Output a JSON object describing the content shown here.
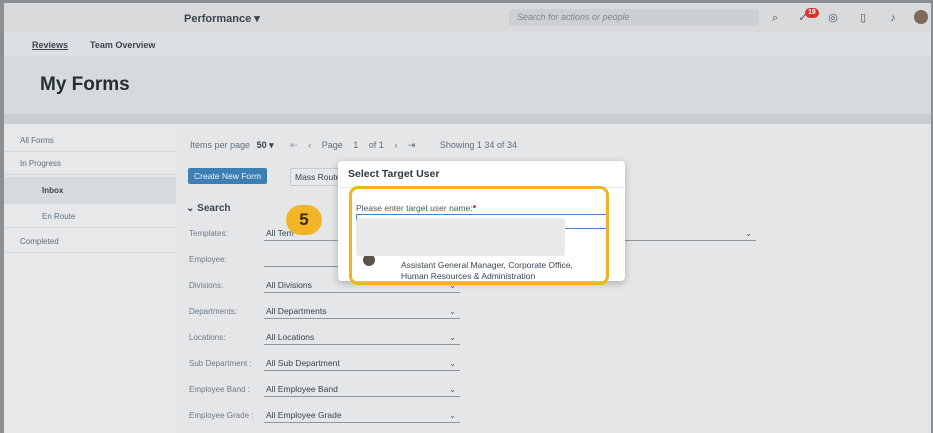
{
  "shell": {
    "app_title": "Performance ▾",
    "search_placeholder": "Search for actions or people",
    "notification_count": "19"
  },
  "subnav": {
    "reviews": "Reviews",
    "team_overview": "Team Overview"
  },
  "page": {
    "title": "My Forms"
  },
  "sidebar": {
    "items": [
      {
        "label": "All Forms"
      },
      {
        "label": "In Progress"
      },
      {
        "label": "Inbox"
      },
      {
        "label": "En Route"
      },
      {
        "label": "Completed"
      }
    ]
  },
  "pager": {
    "items_per_page_label": "Items per page",
    "items_per_page_value": "50",
    "first": "⇤",
    "prev": "‹",
    "page_label": "Page",
    "page_value": "1",
    "of_label": "of 1",
    "next": "›",
    "last": "⇥",
    "showing": "Showing 1 34 of 34"
  },
  "actions": {
    "create_new_form": "Create New Form",
    "mass_route": "Mass Route"
  },
  "search": {
    "heading": "Search",
    "filters": [
      {
        "label": "Templates:",
        "value": "All Tem"
      },
      {
        "label": "Employee:",
        "value": ""
      },
      {
        "label": "Divisions:",
        "value": "All Divisions"
      },
      {
        "label": "Departments:",
        "value": "All Departments"
      },
      {
        "label": "Locations:",
        "value": "All Locations"
      },
      {
        "label": "Sub Department :",
        "value": "All Sub Department"
      },
      {
        "label": "Employee Band :",
        "value": "All Employee Band"
      },
      {
        "label": "Employee Grade :",
        "value": "All Employee Grade"
      }
    ]
  },
  "dialog": {
    "title": "Select Target User",
    "field_label": "Please enter target user name:",
    "required_mark": "*",
    "suggestion_line1": "Assistant General Manager, Corporate Office,",
    "suggestion_line2": "Human Resources & Administration"
  },
  "callout": {
    "step_number": "5"
  },
  "colors": {
    "highlight": "#f0b323",
    "primary_button": "#3d7fb3",
    "notification": "#d9342b"
  }
}
